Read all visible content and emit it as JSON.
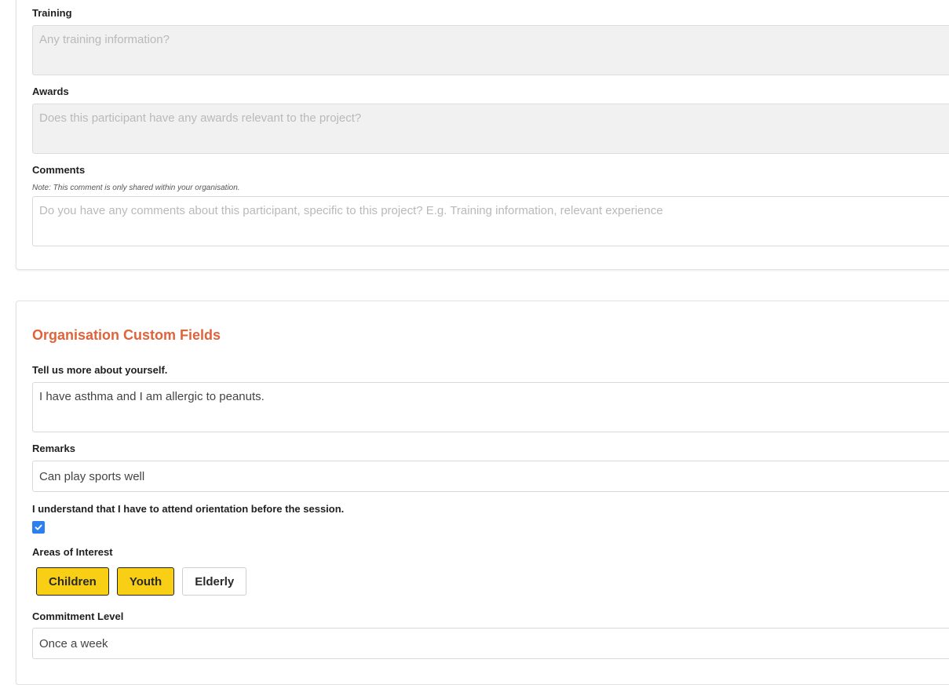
{
  "details": {
    "training": {
      "label": "Training",
      "placeholder": "Any training information?"
    },
    "awards": {
      "label": "Awards",
      "placeholder": "Does this participant have any awards relevant to the project?"
    },
    "comments": {
      "label": "Comments",
      "note": "Note: This comment is only shared within your organisation.",
      "placeholder": "Do you have any comments about this participant, specific to this project? E.g. Training information, relevant experience"
    }
  },
  "custom": {
    "title": "Organisation Custom Fields",
    "about": {
      "label": "Tell us more about yourself.",
      "value": "I have asthma and I am allergic to peanuts."
    },
    "remarks": {
      "label": "Remarks",
      "value": "Can play sports well"
    },
    "orientation": {
      "label": "I understand that I have to attend orientation before the session.",
      "checked": true
    },
    "interests": {
      "label": "Areas of Interest",
      "options": [
        {
          "label": "Children",
          "selected": true
        },
        {
          "label": "Youth",
          "selected": true
        },
        {
          "label": "Elderly",
          "selected": false
        }
      ]
    },
    "commitment": {
      "label": "Commitment Level",
      "value": "Once a week"
    }
  },
  "colors": {
    "accent_title": "#e0633a",
    "chip_selected": "#f9cf16",
    "checkbox": "#2d7ff0"
  }
}
